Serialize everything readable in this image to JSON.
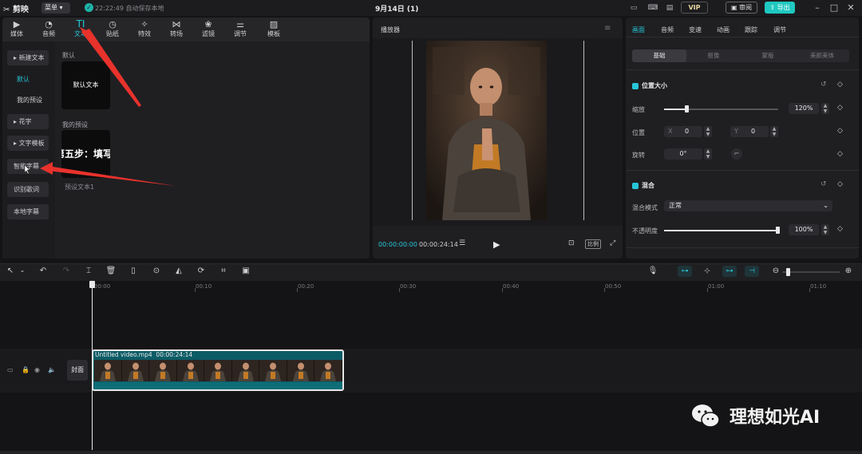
{
  "titlebar": {
    "app_name": "剪映",
    "menu_label": "菜单",
    "save_status": "22:22:49 自动保存本地",
    "project_title": "9月14日 (1)",
    "vip_label": "VIP",
    "review_label": "审阅",
    "export_label": "导出"
  },
  "toolbar": {
    "tabs": [
      {
        "label": "媒体",
        "icon": "media-icon"
      },
      {
        "label": "音频",
        "icon": "audio-icon"
      },
      {
        "label": "文本",
        "icon": "text-icon",
        "active": true
      },
      {
        "label": "贴纸",
        "icon": "sticker-icon"
      },
      {
        "label": "特效",
        "icon": "effects-icon"
      },
      {
        "label": "转场",
        "icon": "transition-icon"
      },
      {
        "label": "滤镜",
        "icon": "filter-icon"
      },
      {
        "label": "调节",
        "icon": "adjust-icon"
      },
      {
        "label": "模板",
        "icon": "template-icon"
      }
    ]
  },
  "sidebar": {
    "items": [
      {
        "label": "新建文本",
        "expandable": true
      },
      {
        "label": "默认",
        "selected": true
      },
      {
        "label": "我的预设"
      },
      {
        "label": "花字",
        "expandable": true
      },
      {
        "label": "文字模板",
        "expandable": true
      },
      {
        "label": "智能字幕"
      },
      {
        "label": "识别歌词"
      },
      {
        "label": "本地字幕"
      }
    ]
  },
  "library": {
    "default_section": "默认",
    "default_card": "默认文本",
    "mine_section": "我的预设",
    "mine_card": "第五步：填写",
    "mine_caption": "预设文本1"
  },
  "player": {
    "title": "播放器",
    "current_time": "00:00:00:00",
    "total_time": "00:00:24:14",
    "ratio_label": "比例"
  },
  "properties": {
    "tabs": [
      "画面",
      "音频",
      "变速",
      "动画",
      "跟踪",
      "调节"
    ],
    "active_tab": "画面",
    "subtabs": [
      "基础",
      "抠像",
      "蒙版",
      "美颜美体"
    ],
    "active_subtab": "基础",
    "position_size": {
      "title": "位置大小",
      "scale_label": "缩放",
      "scale_value": "120%",
      "scale_fraction": 0.2,
      "position_label": "位置",
      "x_label": "X",
      "x_value": "0",
      "y_label": "Y",
      "y_value": "0",
      "rotate_label": "旋转",
      "rotate_value": "0°"
    },
    "blend": {
      "title": "混合",
      "mode_label": "混合模式",
      "mode_value": "正常",
      "opacity_label": "不透明度",
      "opacity_value": "100%",
      "opacity_fraction": 1.0
    }
  },
  "timeline": {
    "ruler_ticks": [
      "00:00",
      "00:10",
      "00:20",
      "00:30",
      "00:40",
      "00:50",
      "01:00",
      "01:10"
    ],
    "cover_label": "封面",
    "clip": {
      "name": "Untitled video.mp4",
      "duration": "00:00:24:14"
    }
  },
  "watermark": {
    "text": "理想如光AI"
  },
  "colors": {
    "accent": "#26c6d8",
    "export": "#1fc8c0",
    "annotation_arrow": "#e8322c",
    "clip": "#0c5c66"
  }
}
